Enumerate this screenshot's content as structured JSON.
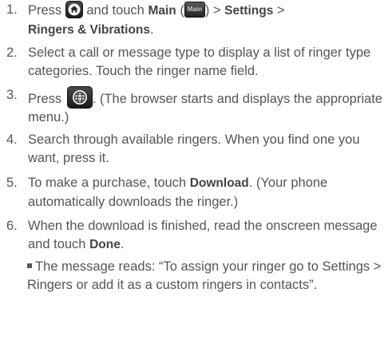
{
  "steps": [
    {
      "number": "1.",
      "t1": "Press",
      "t2": "and touch",
      "b1": "Main",
      "t3": "(",
      "main_icon_label": "Main",
      "t4": ") > ",
      "b2": "Settings",
      "t5": " >",
      "b3": "Ringers & Vibrations",
      "t6": "."
    },
    {
      "number": "2.",
      "text": "Select a call or message type to display a list of ringer type categories. Touch the ringer name field."
    },
    {
      "number": "3.",
      "t1": "Press",
      "t2": ". (The browser starts and displays the appropriate menu.)"
    },
    {
      "number": "4.",
      "text": "Search through available ringers. When you find one you want, press it."
    },
    {
      "number": "5.",
      "t1": "To make a purchase, touch ",
      "b1": "Download",
      "t2": ". (Your phone automatically downloads the ringer.)"
    },
    {
      "number": "6.",
      "t1": "When the download is finished, read the onscreen message and touch ",
      "b1": "Done",
      "t2": "."
    }
  ],
  "note": "The message reads: “To assign your ringer go to Settings > Ringers or add it as a custom ringers in contacts”.",
  "icons": {
    "home": "home-icon",
    "main": "main-menu-icon",
    "browser": "browser-icon"
  },
  "colors": {
    "text": "#555555",
    "bold_text": "#444444",
    "icon_bg": "#2a2a2a"
  }
}
